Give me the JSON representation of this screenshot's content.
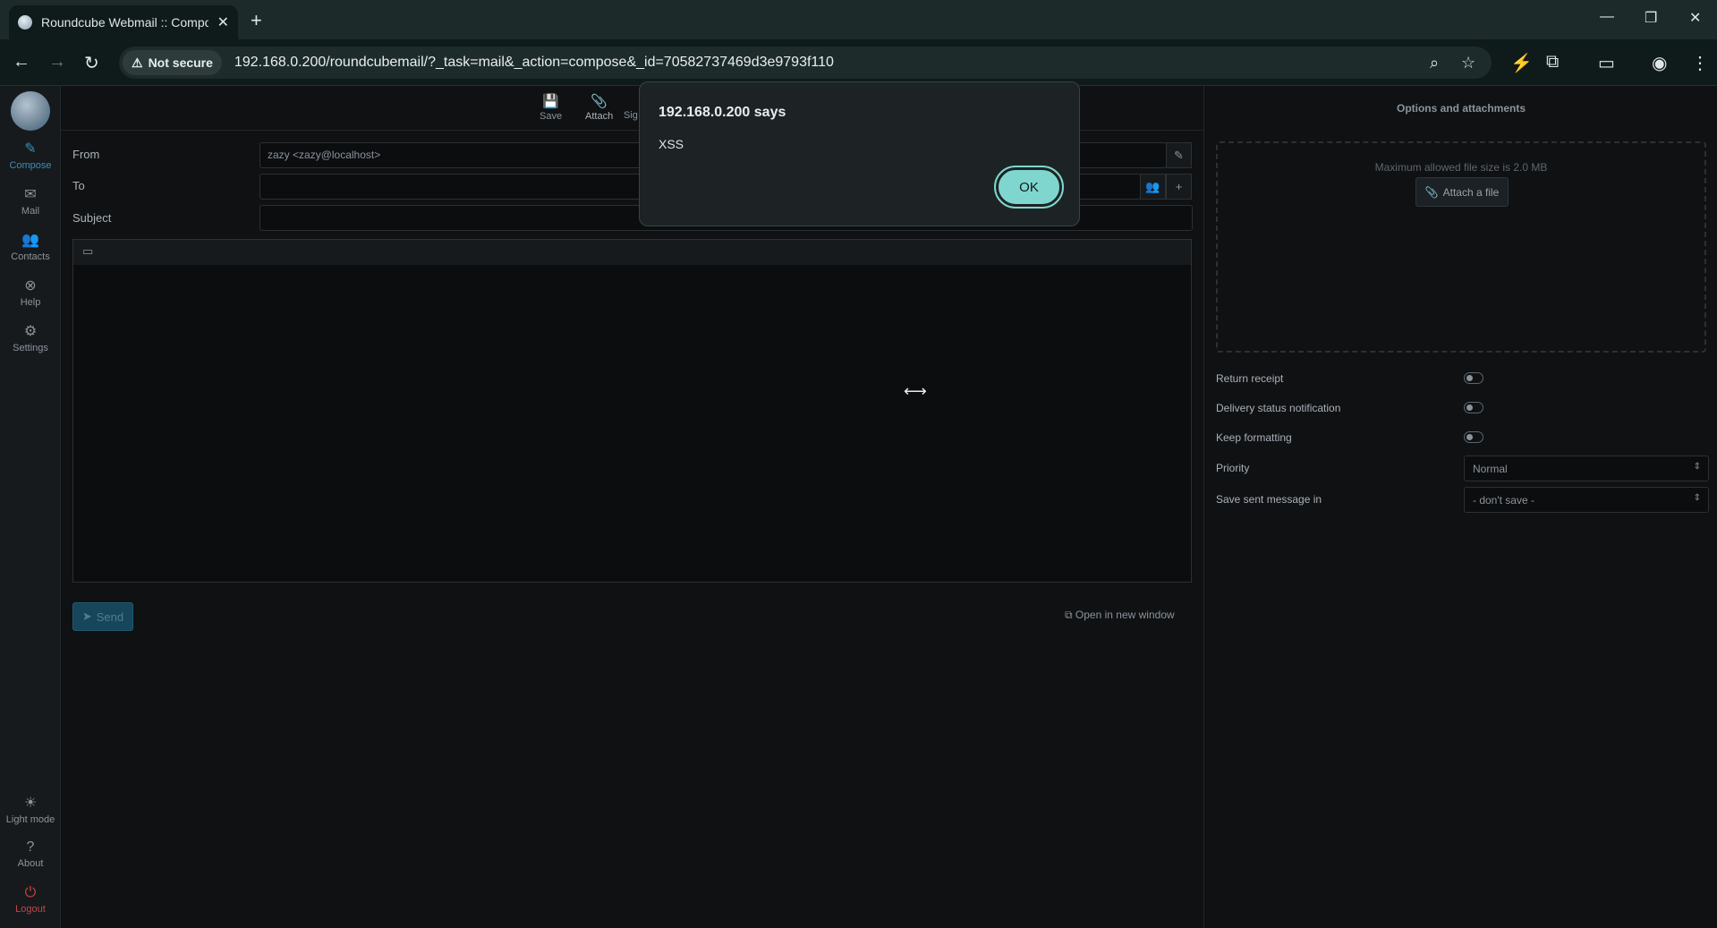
{
  "browser": {
    "tab_title": "Roundcube Webmail :: Compose",
    "new_tab": "+",
    "security_chip": "Not secure",
    "url": "192.168.0.200/roundcubemail/?_task=mail&_action=compose&_id=70582737469d3e9793f110"
  },
  "sidebar": {
    "compose": "Compose",
    "mail": "Mail",
    "contacts": "Contacts",
    "help": "Help",
    "settings": "Settings",
    "light_mode": "Light mode",
    "about": "About",
    "logout": "Logout"
  },
  "toolbar": {
    "save": "Save",
    "attach": "Attach",
    "signature": "Sig"
  },
  "form": {
    "from_label": "From",
    "from_value": "zazy <zazy@localhost>",
    "to_label": "To",
    "subject_label": "Subject"
  },
  "actions": {
    "send": "Send",
    "open_new_window": "Open in new window"
  },
  "options": {
    "title": "Options and attachments",
    "max_size": "Maximum allowed file size is 2.0 MB",
    "attach_file": "Attach a file",
    "return_receipt": "Return receipt",
    "delivery_status": "Delivery status notification",
    "keep_formatting": "Keep formatting",
    "priority_label": "Priority",
    "priority_value": "Normal",
    "save_sent_label": "Save sent message in",
    "save_sent_value": "- don't save -"
  },
  "dialog": {
    "title": "192.168.0.200 says",
    "message": "XSS",
    "ok": "OK"
  },
  "colors": {
    "accent": "#3b8fb8",
    "ok_button": "#7fd6cf",
    "logout": "#c84444"
  }
}
